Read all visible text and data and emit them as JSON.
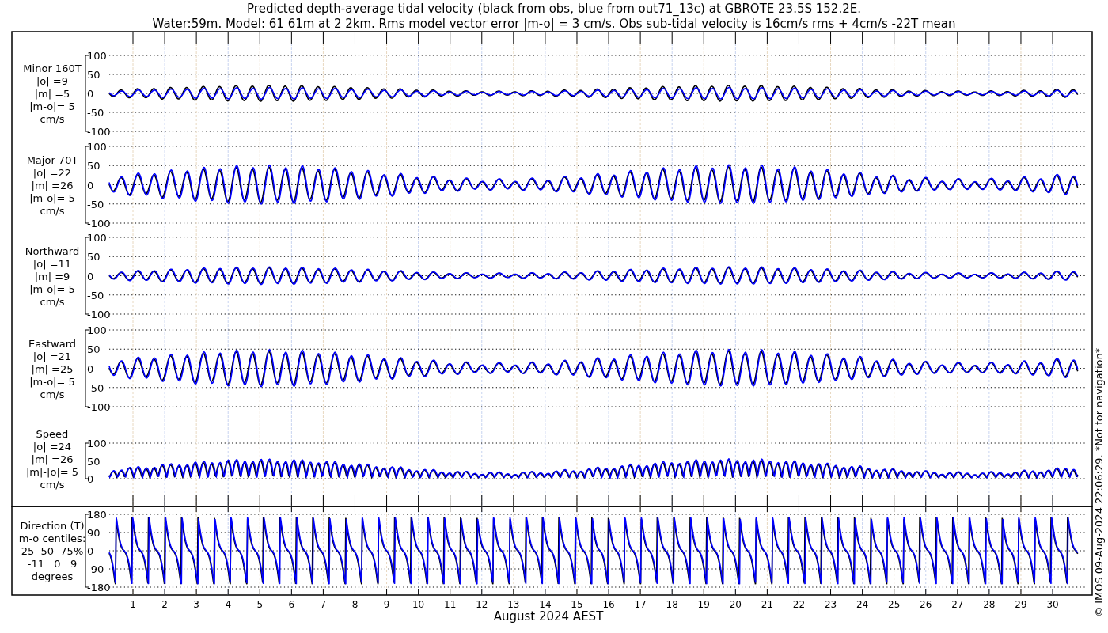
{
  "title_lines": [
    "Predicted depth-average tidal velocity (black from obs, blue from out71_13c) at GBROTE 23.5S 152.2E.",
    "Water:59m. Model: 61 61m at 2 2km. Rms model vector error |m-o| = 3 cm/s. Obs sub-tidal velocity is 16cm/s rms + 4cm/s -22T mean"
  ],
  "series": [
    {
      "color": "#000000"
    },
    {
      "color": "#0000ff"
    }
  ],
  "panels": [
    {
      "kind": "minor",
      "label_lines": [
        "Minor 160T",
        "|o| =9",
        "|m| =5",
        "|m-o|= 5",
        "cm/s"
      ],
      "yticks": [
        "100",
        "50",
        "0",
        "-50",
        "-100"
      ]
    },
    {
      "kind": "major",
      "label_lines": [
        "Major 70T",
        "|o| =22",
        "|m| =26",
        "|m-o|= 5",
        "cm/s"
      ],
      "yticks": [
        "100",
        "50",
        "0",
        "-50",
        "-100"
      ]
    },
    {
      "kind": "northward",
      "label_lines": [
        "Northward",
        "|o| =11",
        "|m| =9",
        "|m-o|= 5",
        "cm/s"
      ],
      "yticks": [
        "100",
        "50",
        "0",
        "-50",
        "-100"
      ]
    },
    {
      "kind": "eastward",
      "label_lines": [
        "Eastward",
        "|o| =21",
        "|m| =25",
        "|m-o|= 5",
        "cm/s"
      ],
      "yticks": [
        "100",
        "50",
        "0",
        "-50",
        "-100"
      ]
    },
    {
      "kind": "speed",
      "label_lines": [
        "Speed",
        "|o| =24",
        "|m| =26",
        "|m|-|o|= 5",
        "cm/s"
      ],
      "yticks": [
        "100",
        "50",
        "0"
      ]
    },
    {
      "kind": "direction",
      "label_lines": [
        "Direction (T)",
        "m-o centiles:",
        "25  50  75%",
        "-11   0   9",
        "degrees"
      ],
      "yticks": [
        "180",
        "90",
        "0",
        "-90",
        "-180"
      ]
    }
  ],
  "x_ticks": [
    "1",
    "2",
    "3",
    "4",
    "5",
    "6",
    "7",
    "8",
    "9",
    "10",
    "11",
    "12",
    "13",
    "14",
    "15",
    "16",
    "17",
    "18",
    "19",
    "20",
    "21",
    "22",
    "23",
    "24",
    "25",
    "26",
    "27",
    "28",
    "29",
    "30"
  ],
  "xlabel": "August 2024 AEST",
  "credit": "© IMOS 09-Aug-2024 22:06:29. *Not for navigation*"
}
